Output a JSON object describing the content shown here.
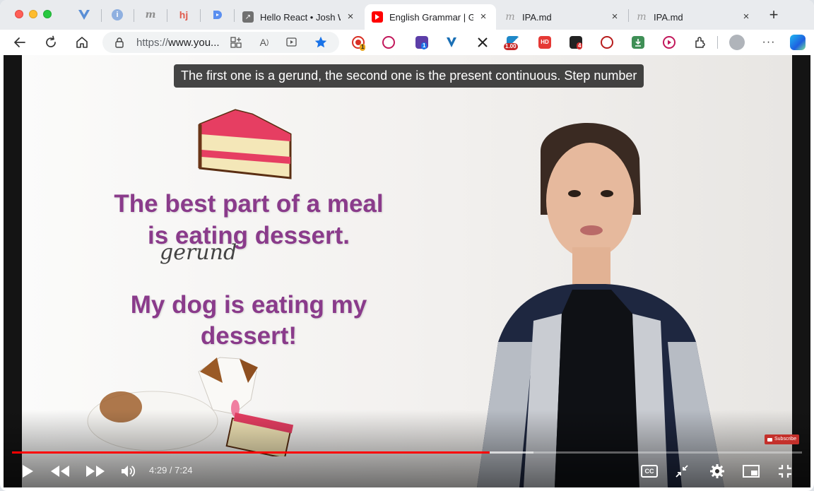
{
  "tabs": {
    "pinned": [
      "vue-devtools",
      "info",
      "m-notes",
      "hj",
      "d-app"
    ],
    "items": [
      {
        "title": "Hello React • Josh W",
        "favicon": "arrow-external-icon"
      },
      {
        "title": "English Grammar | GE",
        "favicon": "youtube-icon",
        "active": true
      },
      {
        "title": "IPA.md",
        "favicon": "m-icon"
      },
      {
        "title": "IPA.md",
        "favicon": "m-icon"
      }
    ],
    "new_tab": "+"
  },
  "toolbar": {
    "url_scheme": "https://",
    "url_host": "www.you...",
    "badges": {
      "record": "1",
      "puzzle": "1",
      "speed": "1.00",
      "hd": "HD",
      "mail": "4"
    }
  },
  "video": {
    "caption": "The first one is a gerund, the second one is the present continuous. Step number",
    "slide": {
      "line1": "The best part of  a meal",
      "line2": "is eating dessert.",
      "annotation": "gerund",
      "line3": "My dog is eating my",
      "line4": "dessert!"
    },
    "subscribe_label": "Subscribe",
    "time_current": "4:29",
    "time_separator": " / ",
    "time_total": "7:24",
    "progress_played": 0.605,
    "progress_buffered": 0.66,
    "cc_label": "CC"
  },
  "colors": {
    "progress": "#ff0000",
    "slide_text": "#8a3b8b",
    "youtube": "#ff0000",
    "accent_star": "#1a73e8"
  }
}
